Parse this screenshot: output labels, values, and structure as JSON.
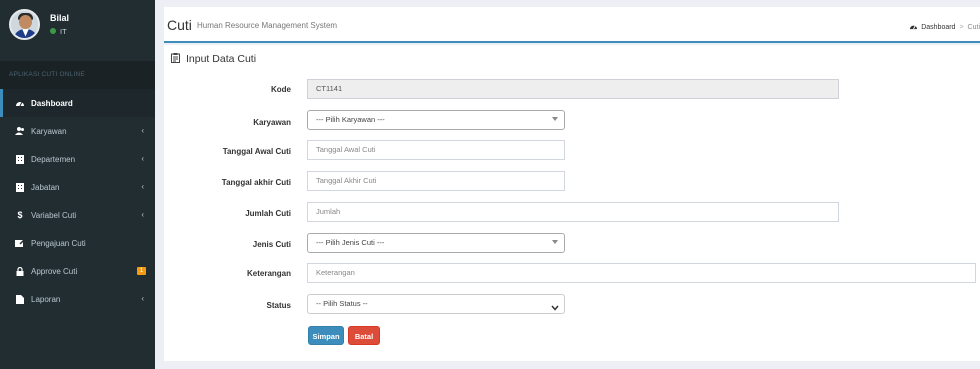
{
  "user": {
    "name": "Bilal",
    "status": "IT"
  },
  "sidebar": {
    "header": "APLIKASI CUTI ONLINE",
    "items": [
      {
        "label": "Dashboard",
        "icon": "dashboard-icon",
        "active": true
      },
      {
        "label": "Karyawan",
        "icon": "users-icon",
        "chevron": true
      },
      {
        "label": "Departemen",
        "icon": "building-icon",
        "chevron": true
      },
      {
        "label": "Jabatan",
        "icon": "building-icon",
        "chevron": true
      },
      {
        "label": "Variabel Cuti",
        "icon": "dollar-icon",
        "chevron": true
      },
      {
        "label": "Pengajuan Cuti",
        "icon": "edit-icon"
      },
      {
        "label": "Approve Cuti",
        "icon": "lock-icon",
        "badge": "1"
      },
      {
        "label": "Laporan",
        "icon": "file-icon",
        "chevron": true
      }
    ]
  },
  "header": {
    "title": "Cuti",
    "subtitle": "Human Resource Management System",
    "breadcrumb": {
      "home": "Dashboard",
      "current": "Cuti"
    }
  },
  "form": {
    "title": "Input Data Cuti",
    "kode": {
      "label": "Kode",
      "value": "CT1141"
    },
    "karyawan": {
      "label": "Karyawan",
      "value": "--- Pilih Karyawan ---"
    },
    "tanggal_awal": {
      "label": "Tanggal Awal Cuti",
      "placeholder": "Tanggal Awal Cuti"
    },
    "tanggal_akhir": {
      "label": "Tanggal akhir Cuti",
      "placeholder": "Tanggal Akhir Cuti"
    },
    "jumlah": {
      "label": "Jumlah Cuti",
      "placeholder": "Jumlah"
    },
    "jenis": {
      "label": "Jenis Cuti",
      "value": "--- Pilih Jenis Cuti ---"
    },
    "keterangan": {
      "label": "Keterangan",
      "placeholder": "Keterangan"
    },
    "status": {
      "label": "Status",
      "value": "-- Pilih Status --"
    },
    "save_label": "Simpan",
    "cancel_label": "Batal"
  },
  "colors": {
    "sidebar": "#222d32",
    "accent": "#3c8dbc",
    "danger": "#dd4b39",
    "badge": "#f39c12"
  }
}
